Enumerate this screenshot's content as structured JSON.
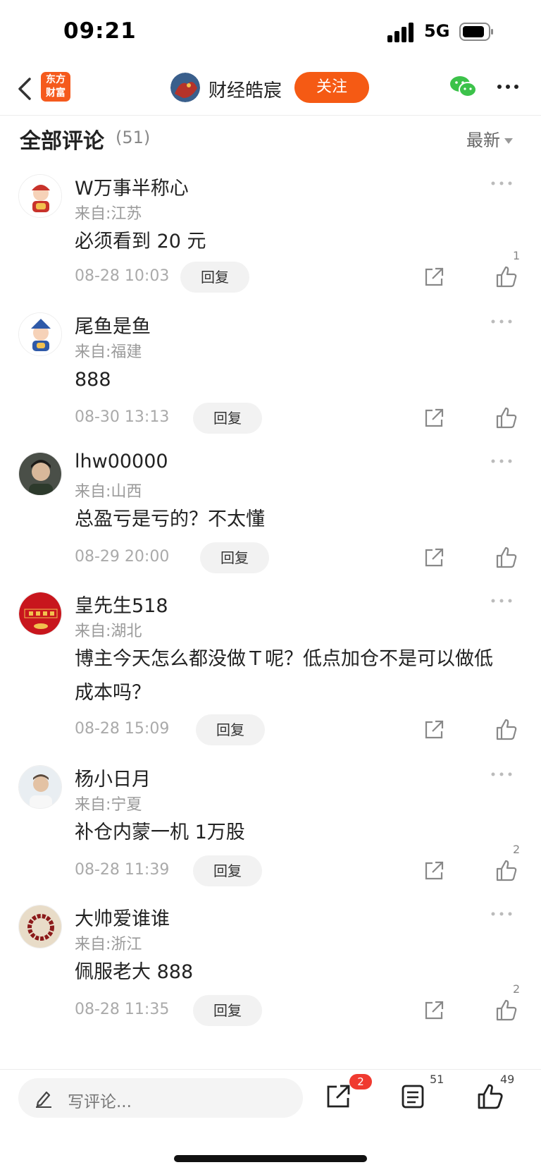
{
  "status_bar": {
    "time": "09:21",
    "network": "5G"
  },
  "nav": {
    "logo_line1": "东方",
    "logo_line2": "财富",
    "author_name": "财经皓宸",
    "follow_label": "关注"
  },
  "section": {
    "title": "全部评论",
    "count": "(51)",
    "sort_label": "最新"
  },
  "comments": [
    {
      "name": "W万事半称心",
      "location": "来自:江苏",
      "text": "必须看到 20 元",
      "time": "08-28 10:03",
      "reply_label": "回复",
      "likes": "1"
    },
    {
      "name": "尾鱼是鱼",
      "location": "来自:福建",
      "text": "888",
      "time": "08-30 13:13",
      "reply_label": "回复",
      "likes": ""
    },
    {
      "name": "lhw00000",
      "location": "来自:山西",
      "text": "总盈亏是亏的？不太懂",
      "time": "08-29 20:00",
      "reply_label": "回复",
      "likes": ""
    },
    {
      "name": "皇先生518",
      "location": "来自:湖北",
      "text": "博主今天怎么都没做Ｔ呢？低点加仓不是可以做低成本吗？",
      "time": "08-28 15:09",
      "reply_label": "回复",
      "likes": ""
    },
    {
      "name": "杨小日月",
      "location": "来自:宁夏",
      "text": "补仓内蒙一机 1万股",
      "time": "08-28 11:39",
      "reply_label": "回复",
      "likes": "2"
    },
    {
      "name": "大帅爱谁谁",
      "location": "来自:浙江",
      "text": "佩服老大 888",
      "time": "08-28 11:35",
      "reply_label": "回复",
      "likes": "2"
    }
  ],
  "bottom_bar": {
    "placeholder": "写评论...",
    "share_badge": "2",
    "comment_count": "51",
    "like_count": "49"
  }
}
